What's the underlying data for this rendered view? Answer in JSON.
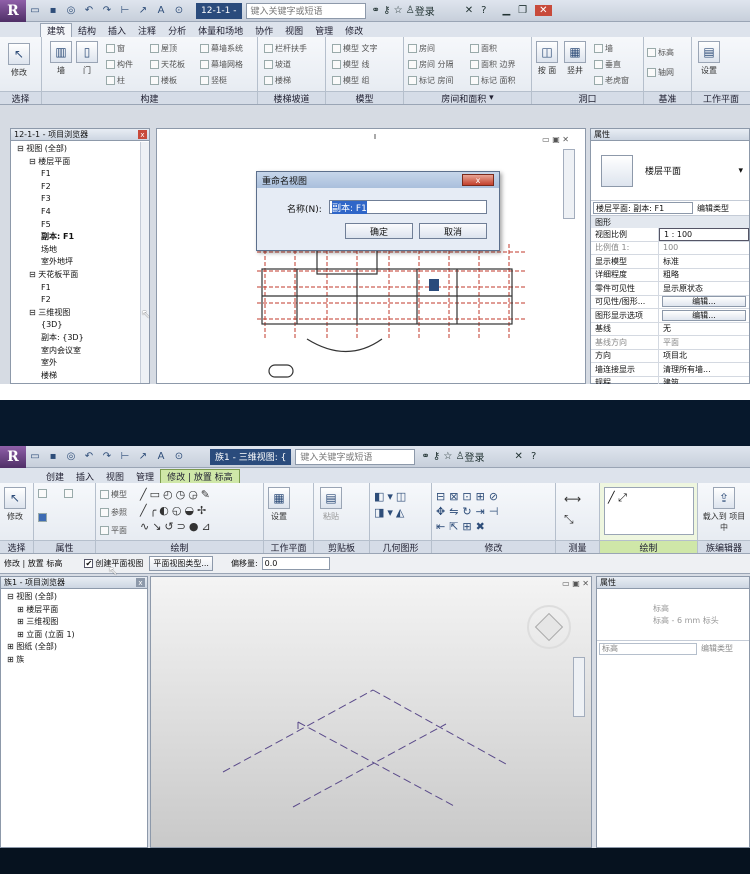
{
  "top": {
    "title_tab": "12-1-1 -",
    "search_placeholder": "键入关键字或短语",
    "login": "登录",
    "tabs": [
      "建筑",
      "结构",
      "插入",
      "注释",
      "分析",
      "体量和场地",
      "协作",
      "视图",
      "管理",
      "修改"
    ],
    "active_tab": "建筑",
    "ribbon_groups": [
      "选择",
      "构建",
      "楼梯坡道",
      "模型",
      "房间和面积",
      "洞口",
      "基准",
      "工作平面"
    ],
    "modify_label": "修改",
    "build_big": [
      "墙",
      "门"
    ],
    "build_small": [
      "窗",
      "屋顶",
      "幕墙系统",
      "构件",
      "天花板",
      "幕墙网格",
      "柱",
      "楼板",
      "竖梃"
    ],
    "stairs_items": [
      "栏杆扶手",
      "坡道",
      "楼梯"
    ],
    "model_items": [
      "模型 文字",
      "模型 线",
      "模型 组"
    ],
    "room_items": [
      "房间",
      "房间 分隔",
      "标记 房间",
      "面积",
      "面积 边界",
      "标记 面积"
    ],
    "opening_items": [
      "按 面",
      "竖井",
      "墙",
      "垂直",
      "老虎窗"
    ],
    "datum_items": [
      "标高",
      "轴网"
    ],
    "workplane_items": [
      "设置"
    ],
    "browser_title": "12-1-1 - 项目浏览器",
    "tree": [
      "视图 (全部)",
      "楼层平面",
      "F1",
      "F2",
      "F3",
      "F4",
      "F5",
      "副本: F1",
      "场地",
      "室外地坪",
      "天花板平面",
      "F1",
      "F2",
      "三维视图",
      "{3D}",
      "副本: {3D}",
      "室内会议室",
      "室外",
      "楼梯"
    ],
    "dialog": {
      "title": "重命名视图",
      "name_label": "名称(N):",
      "name_value": "副本: F1",
      "ok": "确定",
      "cancel": "取消"
    },
    "props": {
      "title": "属性",
      "type_name": "楼层平面",
      "selector": "楼层平面: 副本: F1",
      "edit_type": "编辑类型",
      "section": "图形",
      "rows": [
        [
          "视图比例",
          "1 : 100"
        ],
        [
          "比例值 1:",
          "100"
        ],
        [
          "显示模型",
          "标准"
        ],
        [
          "详细程度",
          "粗略"
        ],
        [
          "零件可见性",
          "显示原状态"
        ],
        [
          "可见性/图形...",
          "编辑..."
        ],
        [
          "图形显示选项",
          "编辑..."
        ],
        [
          "基线",
          "无"
        ],
        [
          "基线方向",
          "平面"
        ],
        [
          "方向",
          "项目北"
        ],
        [
          "墙连接显示",
          "清理所有墙..."
        ],
        [
          "规程",
          "建筑"
        ]
      ]
    }
  },
  "bottom": {
    "title_tab": "族1 - 三维视图: {",
    "search_placeholder": "键入关键字或短语",
    "login": "登录",
    "tabs": [
      "创建",
      "插入",
      "视图",
      "管理",
      "修改 | 放置 标高"
    ],
    "active_tab": "修改 | 放置 标高",
    "ribbon_groups": [
      "选择",
      "属性",
      "绘制",
      "工作平面",
      "剪贴板",
      "几何图形",
      "修改",
      "测量",
      "绘制",
      "族编辑器"
    ],
    "modify_label": "修改",
    "draw_items": [
      "模型",
      "参照",
      "平面"
    ],
    "workplane_items": [
      "设置"
    ],
    "clipboard_items": [
      "粘贴"
    ],
    "load_label": "载入到 项目中",
    "options": {
      "context": "修改 | 放置 标高",
      "checkbox": "创建平面视图",
      "type_button": "平面视图类型...",
      "offset_label": "偏移量:",
      "offset_value": "0.0"
    },
    "browser_title": "族1 - 项目浏览器",
    "tree": [
      "视图 (全部)",
      "楼层平面",
      "三维视图",
      "立面 (立面 1)",
      "图纸 (全部)",
      "族"
    ],
    "props": {
      "title": "属性",
      "type_name": "标高",
      "type_sub": "标高 - 6 mm 标头",
      "selector": "标高",
      "edit_type": "编辑类型"
    }
  },
  "colors": {
    "accent": "#2a4b7c",
    "title_bg": "#07182c",
    "modify_tab": "#cfe7a8",
    "grid_red": "#c0392b",
    "dash_purple": "#5a4a8a"
  }
}
